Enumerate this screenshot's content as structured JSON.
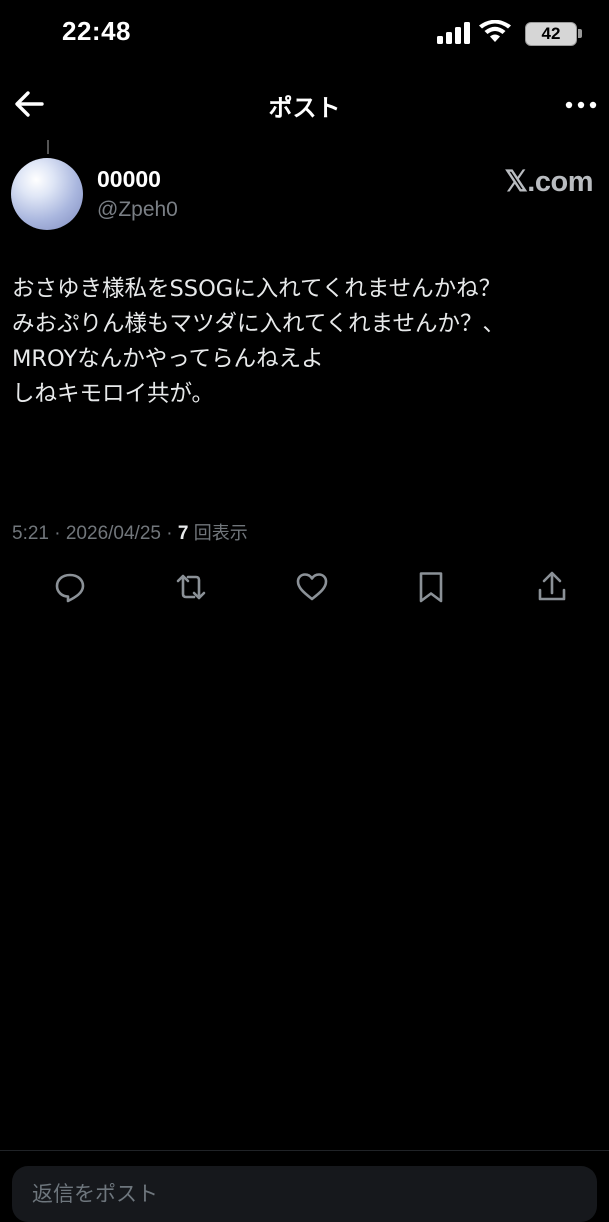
{
  "status_bar": {
    "time": "22:48",
    "battery_level": "42",
    "icons": [
      "signal-icon",
      "wifi-icon",
      "battery-icon"
    ]
  },
  "header": {
    "title": "ポスト",
    "icons": [
      "arrow-left-icon",
      "more-horizontal-icon"
    ]
  },
  "post": {
    "author": {
      "display_name": "00000",
      "handle": "@Zpeh0"
    },
    "watermark": "𝕏.com",
    "text_lines": [
      "おさゆき様私をSSOGに入れてくれませんかね？",
      "みおぷりん様もマツダに入れてくれませんか？、",
      "MROYなんかやってらんねえよ",
      "しねキモロイ共が。"
    ],
    "meta": {
      "timestamp": "5:21 · 2026/04/25 · ",
      "views_count": "7",
      "views_label": "回表示"
    },
    "actions": [
      "reply-icon",
      "repost-icon",
      "like-icon",
      "bookmark-icon",
      "share-icon"
    ]
  },
  "reply_bar": {
    "placeholder": "返信をポスト"
  },
  "colors": {
    "background": "#000000",
    "text": "#e7e9ea",
    "muted": "#71767b",
    "input_bg": "#16181c"
  }
}
